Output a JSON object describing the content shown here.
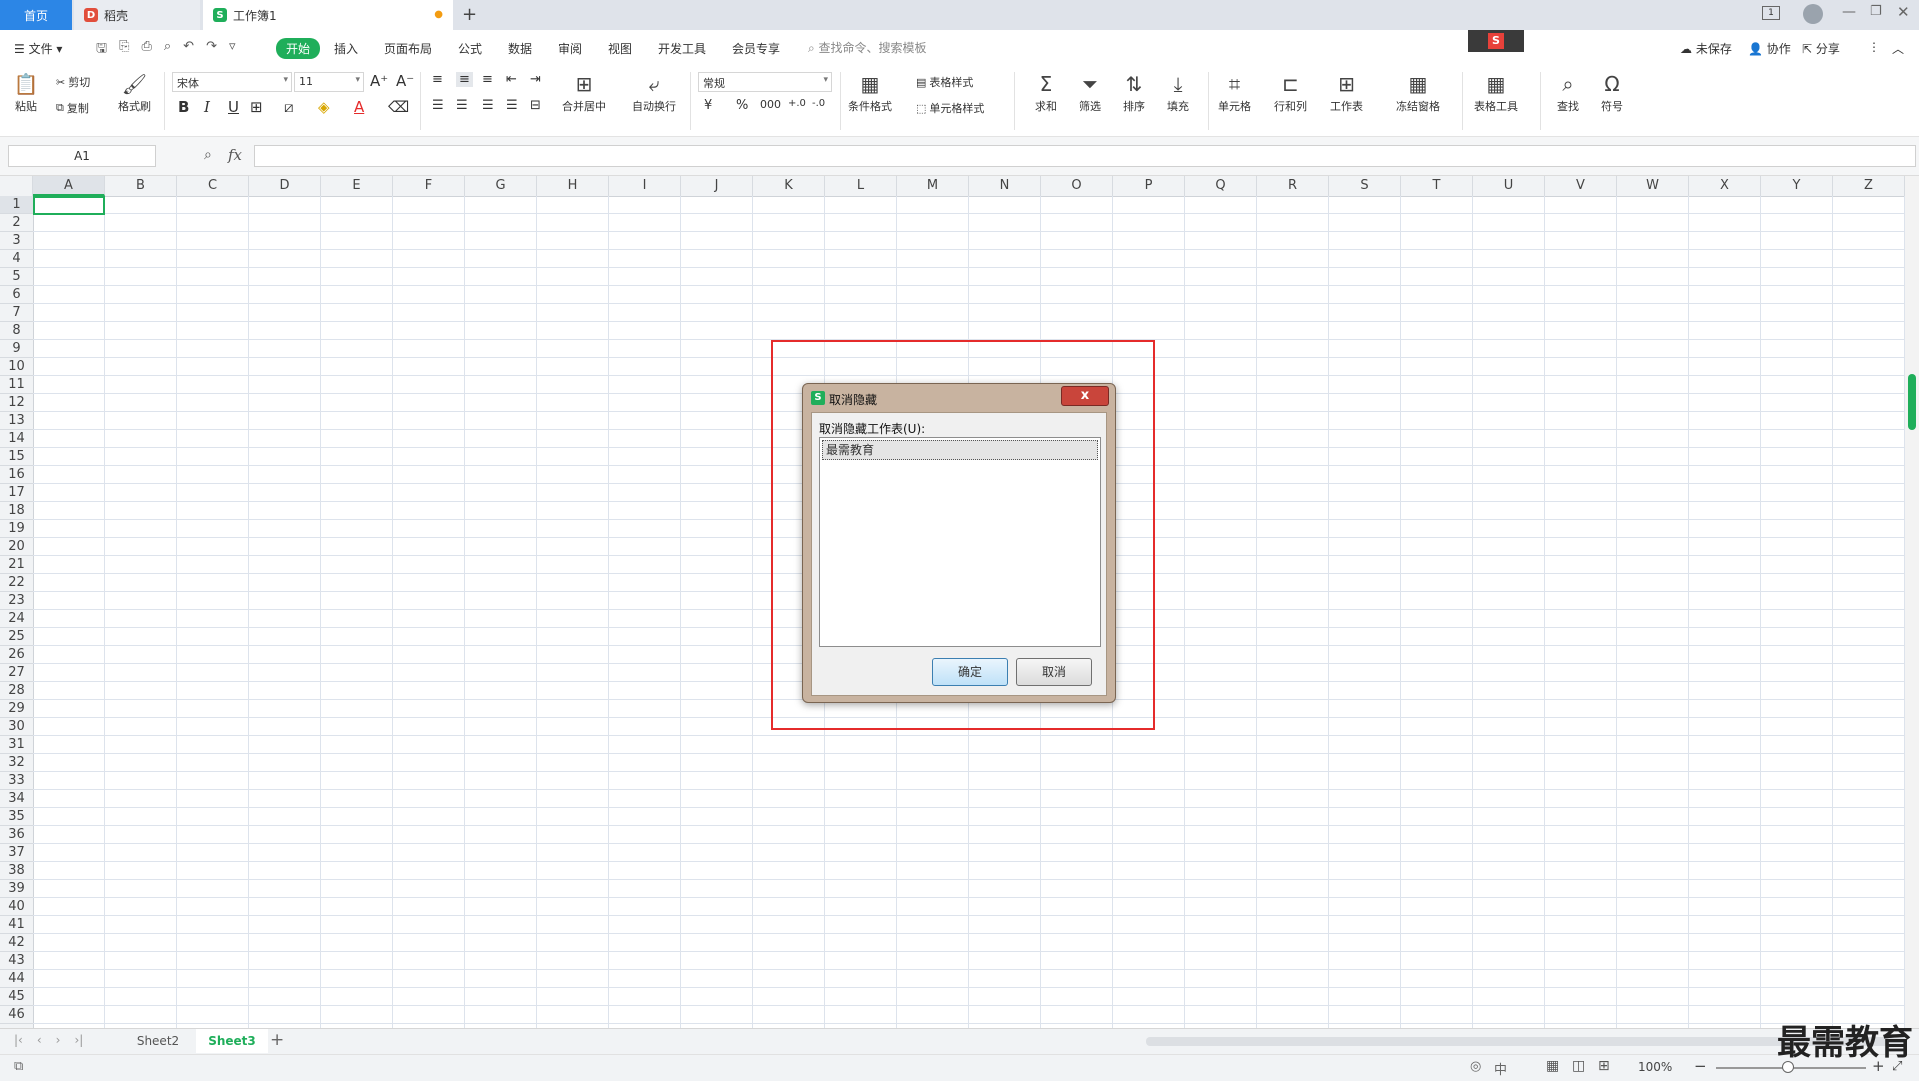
{
  "tabs": {
    "home": "首页",
    "daoke": "稻壳",
    "workbook": "工作簿1"
  },
  "menu": {
    "file": "文件",
    "items": [
      "开始",
      "插入",
      "页面布局",
      "公式",
      "数据",
      "审阅",
      "视图",
      "开发工具",
      "会员专享"
    ],
    "search_placeholder": "查找命令、搜索模板",
    "right": {
      "unsaved": "未保存",
      "collab": "协作",
      "share": "分享"
    }
  },
  "ribbon": {
    "paste": "粘贴",
    "cut": "剪切",
    "copy": "复制",
    "format_painter": "格式刷",
    "font_name": "宋体",
    "font_size": "11",
    "merge": "合并居中",
    "wrap": "自动换行",
    "number_format": "常规",
    "cond_format": "条件格式",
    "table_style": "表格样式",
    "cell_style": "单元格样式",
    "sum": "求和",
    "filter": "筛选",
    "sort": "排序",
    "fill": "填充",
    "cell": "单元格",
    "rowcol": "行和列",
    "sheet": "工作表",
    "freeze": "冻结窗格",
    "table_tools": "表格工具",
    "find": "查找",
    "symbol": "符号"
  },
  "formula_bar": {
    "name_box": "A1",
    "fx": "fx"
  },
  "columns": [
    "A",
    "B",
    "C",
    "D",
    "E",
    "F",
    "G",
    "H",
    "I",
    "J",
    "K",
    "L",
    "M",
    "N",
    "O",
    "P",
    "Q",
    "R",
    "S",
    "T",
    "U",
    "V",
    "W",
    "X",
    "Y",
    "Z"
  ],
  "rows": [
    "1",
    "2",
    "3",
    "4",
    "5",
    "6",
    "7",
    "8",
    "9",
    "10",
    "11",
    "12",
    "13",
    "14",
    "15",
    "16",
    "17",
    "18",
    "19",
    "20",
    "21",
    "22",
    "23",
    "24",
    "25",
    "26",
    "27",
    "28",
    "29",
    "30",
    "31",
    "32",
    "33",
    "34",
    "35",
    "36",
    "37",
    "38",
    "39",
    "40",
    "41",
    "42",
    "43",
    "44",
    "45",
    "46"
  ],
  "sheets": {
    "sheet2": "Sheet2",
    "sheet3": "Sheet3"
  },
  "status": {
    "zoom": "100%"
  },
  "dialog": {
    "title": "取消隐藏",
    "label": "取消隐藏工作表(U):",
    "item": "最需教育",
    "ok": "确定",
    "cancel": "取消",
    "close": "x"
  },
  "watermark": "最需教育",
  "colors": {
    "accent": "#1fae5a",
    "tab_active": "#2c86e6",
    "highlight": "#e52b2b"
  }
}
